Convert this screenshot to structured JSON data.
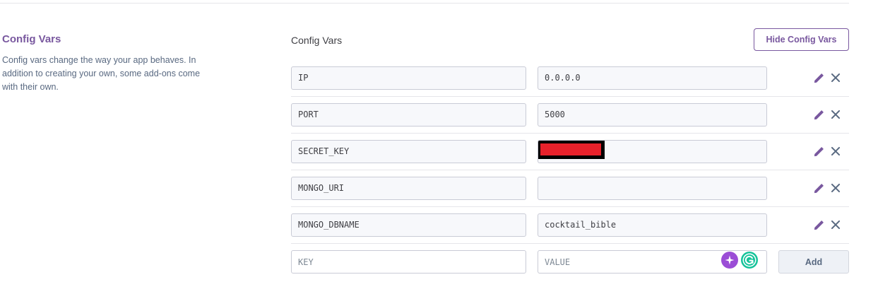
{
  "section": {
    "title": "Config Vars",
    "description": "Config vars change the way your app behaves. In addition to creating your own, some add-ons come with their own."
  },
  "panel": {
    "title": "Config Vars",
    "hide_button": "Hide Config Vars"
  },
  "vars": [
    {
      "key": "IP",
      "value": "0.0.0.0"
    },
    {
      "key": "PORT",
      "value": "5000"
    },
    {
      "key": "SECRET_KEY",
      "value": "",
      "redacted": true
    },
    {
      "key": "MONGO_URI",
      "value": ""
    },
    {
      "key": "MONGO_DBNAME",
      "value": "cocktail_bible"
    }
  ],
  "new_var": {
    "key_placeholder": "KEY",
    "value_placeholder": "VALUE",
    "add_button": "Add"
  },
  "icons": {
    "edit": "pencil-icon",
    "delete": "close-icon",
    "extension_1": "sparkle-icon",
    "extension_2": "grammarly-icon"
  },
  "colors": {
    "accent": "#79589f",
    "text": "#3f3f44",
    "muted": "#596981",
    "redaction_fill": "#e8212b",
    "redaction_border": "#000000",
    "grammarly": "#15c39a"
  }
}
